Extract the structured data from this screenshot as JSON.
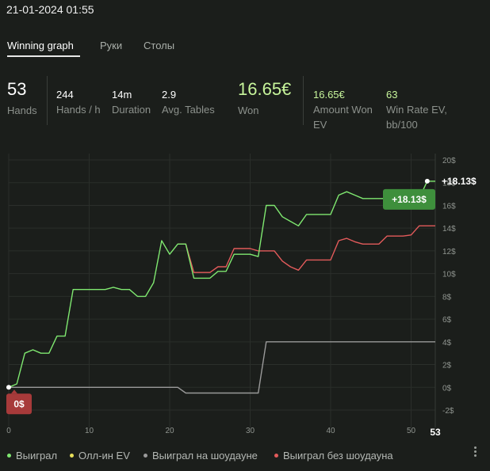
{
  "session": {
    "datetime": "21-01-2024 01:55"
  },
  "tabs": [
    {
      "label": "Winning graph",
      "active": true
    },
    {
      "label": "Руки",
      "active": false
    },
    {
      "label": "Столы",
      "active": false
    }
  ],
  "stats": {
    "hands": {
      "value": "53",
      "label": "Hands"
    },
    "hands_per_hour": {
      "value": "244",
      "label": "Hands / h"
    },
    "duration": {
      "value": "14m",
      "label": "Duration"
    },
    "avg_tables": {
      "value": "2.9",
      "label": "Avg. Tables"
    },
    "won": {
      "value": "16.65€",
      "label": "Won"
    },
    "amount_won_ev": {
      "value": "16.65€",
      "label_line1": "Amount Won",
      "label_line2": "EV"
    },
    "win_rate_ev": {
      "value": "63",
      "label_line1": "Win Rate EV,",
      "label_line2": "bb/100"
    }
  },
  "colors": {
    "accent_green": "#6fe85e",
    "won_series": "#7fe870",
    "showdown_series": "#9a9a9a",
    "non_showdown_series": "#e35b5b",
    "allin_ev_series": "#e8e05a",
    "badge_green": "#3e8f3c",
    "badge_red": "#a73a3a"
  },
  "chart_data": {
    "type": "line",
    "x_ticks": [
      0,
      10,
      20,
      30,
      40,
      50
    ],
    "x_max_label": "53",
    "xlim": [
      0,
      53
    ],
    "y_ticks": [
      -2,
      0,
      2,
      4,
      6,
      8,
      10,
      12,
      14,
      16,
      18,
      20
    ],
    "y_tick_labels": [
      "-2$",
      "0$",
      "2$",
      "4$",
      "6$",
      "8$",
      "10$",
      "12$",
      "14$",
      "16$",
      "18$",
      "20$"
    ],
    "ylim": [
      -2,
      20
    ],
    "grid": true,
    "legend_position": "bottom",
    "end_badge": "+18.13$",
    "end_value_label": "+18.13$",
    "start_badge": "0$",
    "series": [
      {
        "name": "Выиграл",
        "color": "#7fe870",
        "x": [
          0,
          1,
          2,
          3,
          4,
          5,
          6,
          7,
          8,
          9,
          10,
          11,
          12,
          13,
          14,
          15,
          16,
          17,
          18,
          19,
          20,
          21,
          22,
          23,
          24,
          25,
          26,
          27,
          28,
          29,
          30,
          31,
          32,
          33,
          34,
          35,
          36,
          37,
          38,
          39,
          40,
          41,
          42,
          43,
          44,
          45,
          46,
          47,
          48,
          49,
          50,
          51,
          52,
          53
        ],
        "y": [
          0,
          0.3,
          3,
          3.3,
          3,
          3,
          4.5,
          4.5,
          8.6,
          8.6,
          8.6,
          8.6,
          8.6,
          8.8,
          8.6,
          8.6,
          8,
          8,
          9.2,
          12.9,
          11.7,
          12.6,
          12.6,
          9.6,
          9.6,
          9.6,
          10.2,
          10.2,
          11.7,
          11.7,
          11.7,
          11.5,
          16,
          16,
          15,
          14.6,
          14.2,
          15.2,
          15.2,
          15.2,
          15.2,
          16.9,
          17.2,
          16.9,
          16.6,
          16.6,
          16.6,
          16.6,
          16.6,
          16.6,
          16.6,
          16.6,
          18.13,
          18.13
        ]
      },
      {
        "name": "Олл-ин EV",
        "color": "#e8e05a",
        "x": [],
        "y": []
      },
      {
        "name": "Выиграл на шоудауне",
        "color": "#9a9a9a",
        "x": [
          0,
          21,
          22,
          30,
          31,
          32,
          53
        ],
        "y": [
          0,
          0,
          -0.5,
          -0.5,
          -0.5,
          4,
          4
        ]
      },
      {
        "name": "Выиграл без шоудауна",
        "color": "#e35b5b",
        "x": [
          21,
          22,
          23,
          24,
          25,
          26,
          27,
          28,
          29,
          30,
          31,
          32,
          33,
          34,
          35,
          36,
          37,
          38,
          39,
          40,
          41,
          42,
          43,
          44,
          45,
          46,
          47,
          48,
          49,
          50,
          51,
          52,
          53
        ],
        "y": [
          12.6,
          12.6,
          10.1,
          10.1,
          10.1,
          10.6,
          10.6,
          12.2,
          12.2,
          12.2,
          12,
          12,
          12,
          11.1,
          10.6,
          10.3,
          11.2,
          11.2,
          11.2,
          11.2,
          12.9,
          13.1,
          12.8,
          12.6,
          12.6,
          12.6,
          13.3,
          13.3,
          13.3,
          13.4,
          14.2,
          14.2,
          14.2
        ]
      }
    ]
  }
}
